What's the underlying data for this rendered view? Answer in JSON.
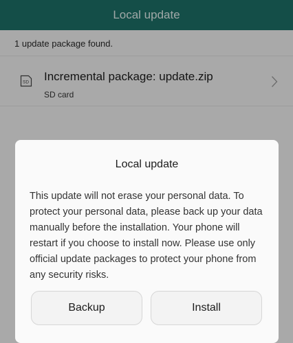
{
  "app_bar": {
    "title": "Local update"
  },
  "info_text": "1 update package found.",
  "package": {
    "title": "Incremental package: update.zip",
    "subtitle": "SD card",
    "icon": "sd-card-icon",
    "icon_text": "SD",
    "chevron_icon": "chevron-right-icon"
  },
  "dialog": {
    "title": "Local update",
    "message": "This update will not erase your personal data. To protect your personal data, please back up your data manually before the installation. Your phone will restart if you choose to install now. Please use only official update packages to protect your phone from any security risks.",
    "backup_label": "Backup",
    "install_label": "Install"
  },
  "colors": {
    "accent": "#1d7068",
    "background": "#f2f2f2",
    "dialog_background": "#fafafa"
  }
}
